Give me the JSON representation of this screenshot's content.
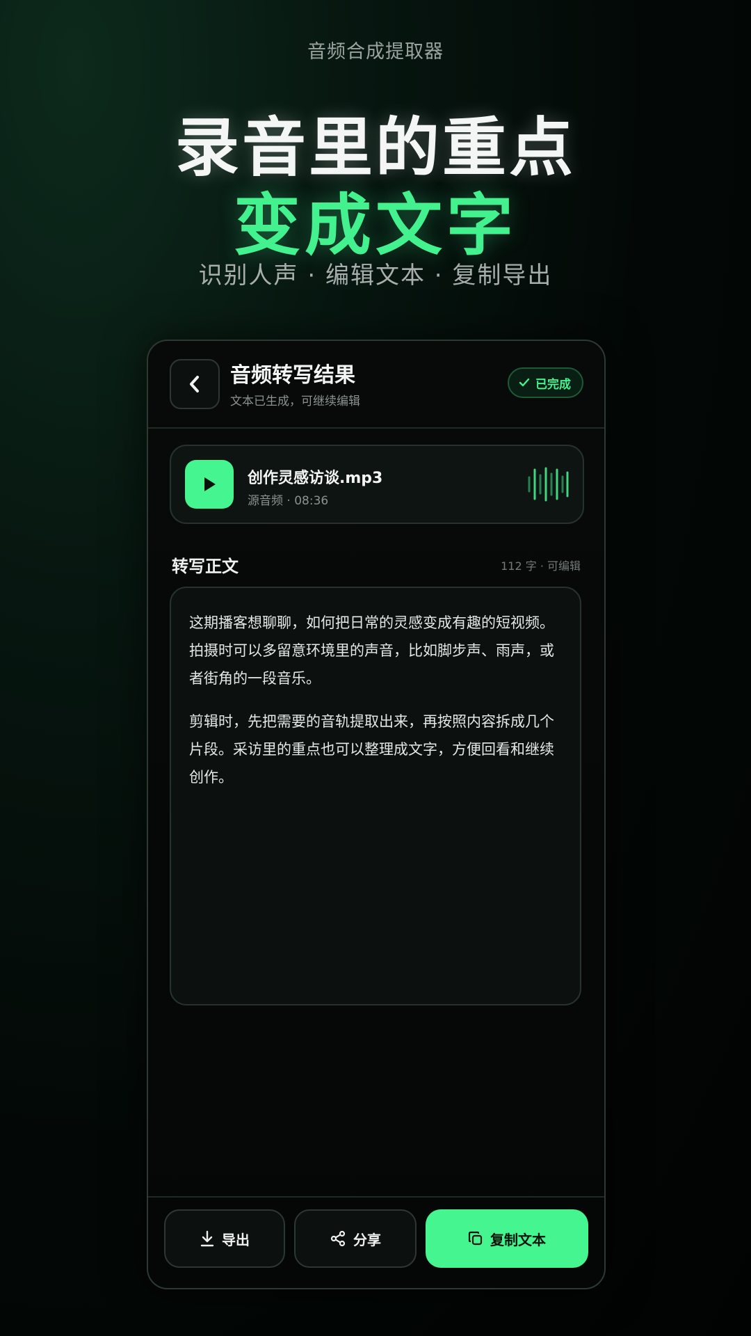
{
  "header": {
    "app_name": "音频合成提取器",
    "hero_line1": "录音里的重点",
    "hero_line2": "变成文字",
    "hero_sub": "识别人声 · 编辑文本 · 复制导出"
  },
  "topbar": {
    "back_icon": "chevron-left-icon",
    "title": "音频转写结果",
    "subtitle": "文本已生成，可继续编辑",
    "status_label": "已完成",
    "status_icon": "check-icon"
  },
  "audio": {
    "file_name": "创作灵感访谈.mp3",
    "meta": "源音频 · 08:36",
    "play_icon": "play-icon",
    "waveform_icon": "waveform-icon"
  },
  "transcript": {
    "section_title": "转写正文",
    "section_meta": "112 字 · 可编辑",
    "paragraphs": [
      "这期播客想聊聊，如何把日常的灵感变成有趣的短视频。拍摄时可以多留意环境里的声音，比如脚步声、雨声，或者街角的一段音乐。",
      "剪辑时，先把需要的音轨提取出来，再按照内容拆成几个片段。采访里的重点也可以整理成文字，方便回看和继续创作。"
    ]
  },
  "actions": {
    "export_label": "导出",
    "export_icon": "download-icon",
    "share_label": "分享",
    "share_icon": "share-icon",
    "copy_label": "复制文本",
    "copy_icon": "copy-icon"
  },
  "colors": {
    "accent": "#45f58f",
    "background": "#030806",
    "card": "#0c1110"
  }
}
